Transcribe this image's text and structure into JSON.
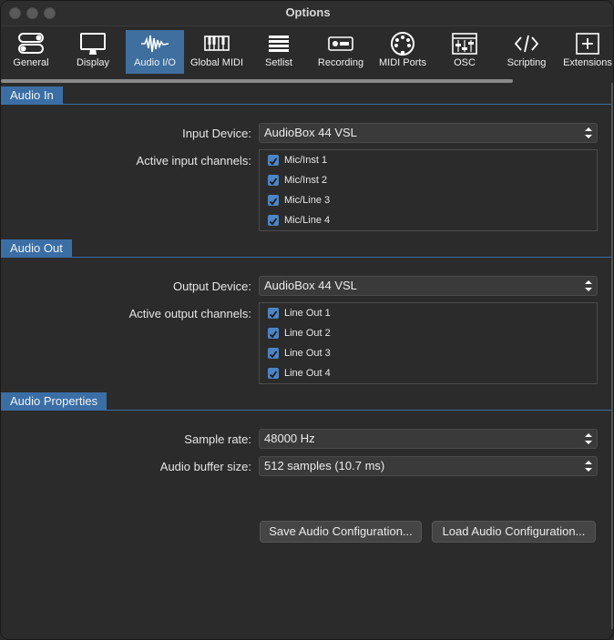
{
  "window": {
    "title": "Options"
  },
  "toolbar": {
    "items": [
      {
        "label": "General",
        "icon": "toggles-icon"
      },
      {
        "label": "Display",
        "icon": "monitor-icon"
      },
      {
        "label": "Audio I/O",
        "icon": "waveform-icon",
        "selected": true
      },
      {
        "label": "Global MIDI",
        "icon": "keyboard-icon"
      },
      {
        "label": "Setlist",
        "icon": "list-icon"
      },
      {
        "label": "Recording",
        "icon": "rec-icon"
      },
      {
        "label": "MIDI Ports",
        "icon": "midi-port-icon"
      },
      {
        "label": "OSC",
        "icon": "mixer-icon"
      },
      {
        "label": "Scripting",
        "icon": "code-icon"
      },
      {
        "label": "Extensions",
        "icon": "plus-icon"
      }
    ]
  },
  "audio_in": {
    "header": "Audio In",
    "device_label": "Input Device:",
    "device_value": "AudioBox 44 VSL",
    "channels_label": "Active input channels:",
    "channels": [
      {
        "label": "Mic/Inst 1",
        "checked": true
      },
      {
        "label": "Mic/Inst 2",
        "checked": true
      },
      {
        "label": "Mic/Line 3",
        "checked": true
      },
      {
        "label": "Mic/Line 4",
        "checked": true
      }
    ]
  },
  "audio_out": {
    "header": "Audio Out",
    "device_label": "Output Device:",
    "device_value": "AudioBox 44 VSL",
    "channels_label": "Active output channels:",
    "channels": [
      {
        "label": "Line Out 1",
        "checked": true
      },
      {
        "label": "Line Out 2",
        "checked": true
      },
      {
        "label": "Line Out 3",
        "checked": true
      },
      {
        "label": "Line Out 4",
        "checked": true
      }
    ]
  },
  "audio_properties": {
    "header": "Audio Properties",
    "sample_rate_label": "Sample rate:",
    "sample_rate_value": "48000 Hz",
    "buffer_label": "Audio buffer size:",
    "buffer_value": "512 samples (10.7 ms)"
  },
  "buttons": {
    "save": "Save Audio Configuration...",
    "load": "Load Audio Configuration..."
  },
  "colors": {
    "accent": "#3a6ea5",
    "checkbox": "#4d84c4",
    "background": "#2b2b2b"
  }
}
